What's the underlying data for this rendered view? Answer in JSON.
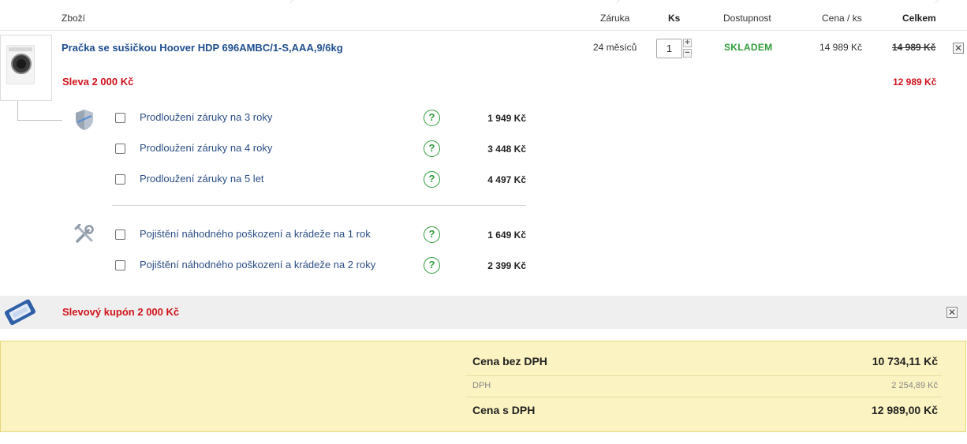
{
  "columns": {
    "product": "Zboží",
    "warranty": "Záruka",
    "qty": "Ks",
    "availability": "Dostupnost",
    "unit_price": "Cena / ks",
    "total": "Celkem"
  },
  "item": {
    "name": "Pračka se sušičkou Hoover HDP 696AMBC/1-S,AAA,9/6kg",
    "warranty": "24 měsíců",
    "quantity": "1",
    "qty_plus": "+",
    "qty_minus": "−",
    "availability": "SKLADEM",
    "unit_price": "14 989 Kč",
    "old_total": "14 989 Kč",
    "discount_label": "Sleva 2 000 Kč",
    "new_total": "12 989 Kč",
    "remove": "✕",
    "image_icon": "washing-machine-icon"
  },
  "services": {
    "warranty_icon": "shield-icon",
    "insurance_icon": "tools-icon",
    "help_symbol": "?",
    "warranty_options": [
      {
        "label": "Prodloužení záruky na 3 roky",
        "price": "1 949 Kč"
      },
      {
        "label": "Prodloužení záruky na 4 roky",
        "price": "3 448 Kč"
      },
      {
        "label": "Prodloužení záruky na 5 let",
        "price": "4 497 Kč"
      }
    ],
    "insurance_options": [
      {
        "label": "Pojištění náhodného poškození a krádeže na 1 rok",
        "price": "1 649 Kč"
      },
      {
        "label": "Pojištění náhodného poškození a krádeže na 2 roky",
        "price": "2 399 Kč"
      }
    ]
  },
  "coupon": {
    "icon": "coupon-ticket-icon",
    "label": "Slevový kupón 2 000 Kč",
    "remove": "✕"
  },
  "summary": {
    "without_vat_label": "Cena bez DPH",
    "without_vat_value": "10 734,11 Kč",
    "vat_label": "DPH",
    "vat_value": "2 254,89 Kč",
    "with_vat_label": "Cena s DPH",
    "with_vat_value": "12 989,00 Kč"
  },
  "colors": {
    "accent_blue": "#1f4f8f",
    "discount_red": "#d0121b",
    "stock_green": "#2f9c3a",
    "summary_bg": "#fbf3c2"
  }
}
